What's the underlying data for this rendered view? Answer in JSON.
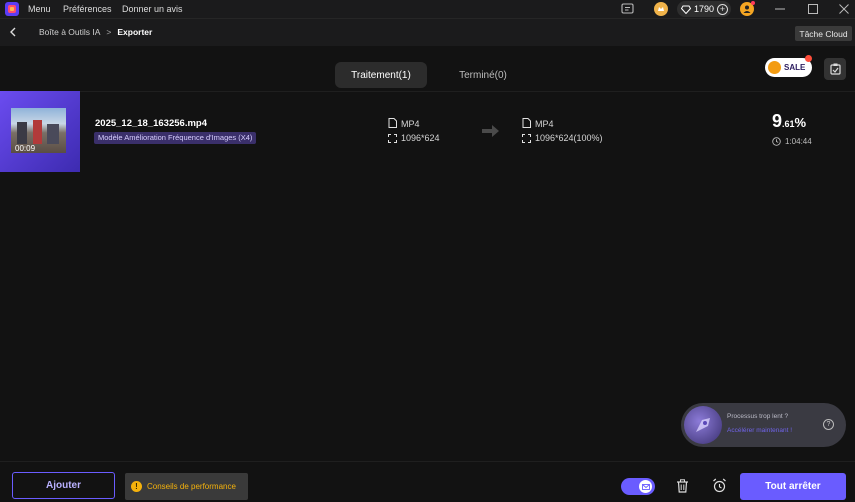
{
  "titlebar": {
    "menu_items": [
      "Menu",
      "Préférences",
      "Donner un avis"
    ],
    "points": "1790",
    "cloud_task_label": "Tâche Cloud"
  },
  "navbar": {
    "breadcrumb_root": "Boîte à Outils IA",
    "breadcrumb_separator": ">",
    "breadcrumb_current": "Exporter"
  },
  "tabs": {
    "processing": "Traitement(1)",
    "done": "Terminé(0)"
  },
  "sale_badge": "SALE",
  "task": {
    "thumb_duration": "00:09",
    "file_name": "2025_12_18_163256.mp4",
    "model_tag": "Modèle Amélioration Fréquence d'Images (X4)",
    "source_format": "MP4",
    "source_resolution": "1096*624",
    "target_format": "MP4",
    "target_resolution": "1096*624(100%)",
    "progress_major": "9",
    "progress_minor": ".61",
    "progress_unit": "%",
    "eta": "1:04:44"
  },
  "slow_popup": {
    "line1": "Processus trop lent ?",
    "line2": "Accélérer maintenant !"
  },
  "footer": {
    "add_label": "Ajouter",
    "tips_label": "Conseils de performance",
    "stop_all_label": "Tout arrêter"
  },
  "colors": {
    "accent": "#6a5cff",
    "thumb_frame": "#5a3fd8",
    "tips_bg": "#3a3a3a",
    "warn": "#f5b20c"
  }
}
